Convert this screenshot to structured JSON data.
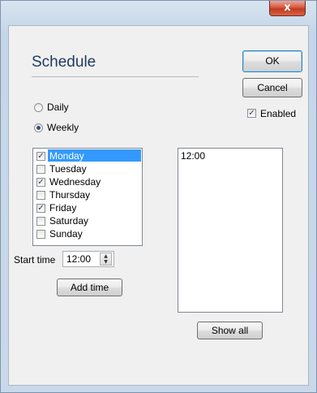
{
  "window": {
    "close_glyph": "x"
  },
  "header": {
    "title": "Schedule"
  },
  "buttons": {
    "ok": "OK",
    "cancel": "Cancel",
    "add_time": "Add time",
    "show_all": "Show all"
  },
  "enabled": {
    "label": "Enabled",
    "checked": true
  },
  "frequency": {
    "options": [
      {
        "label": "Daily",
        "selected": false
      },
      {
        "label": "Weekly",
        "selected": true
      }
    ]
  },
  "days": [
    {
      "label": "Monday",
      "checked": true,
      "selected": true
    },
    {
      "label": "Tuesday",
      "checked": false,
      "selected": false
    },
    {
      "label": "Wednesday",
      "checked": true,
      "selected": false
    },
    {
      "label": "Thursday",
      "checked": false,
      "selected": false
    },
    {
      "label": "Friday",
      "checked": true,
      "selected": false
    },
    {
      "label": "Saturday",
      "checked": false,
      "selected": false
    },
    {
      "label": "Sunday",
      "checked": false,
      "selected": false
    }
  ],
  "start_time": {
    "label": "Start time",
    "value": "12:00"
  },
  "times": [
    "12:00"
  ],
  "icons": {
    "check": "✓",
    "spin_up": "▲",
    "spin_down": "▼"
  }
}
